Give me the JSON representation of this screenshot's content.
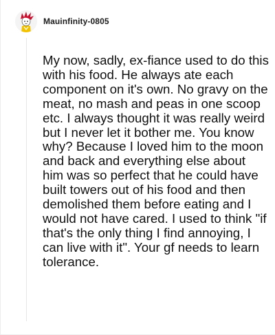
{
  "comment": {
    "username": "Mauinfinity-0805",
    "avatar_icon": "cartoon-character-avatar",
    "body": "My now, sadly, ex-fiance used to do this with his food. He always ate each component on it's own. No gravy on the meat, no mash and peas in one scoop etc. I always thought it was really weird but I never let it bother me. You know why? Because I loved him to the moon and back and everything else about him was so perfect that he could have built towers out of his food and then demolished them before eating and I would not have cared. I used to think \"if that's the only thing I find annoying, I can live with it\". Your gf needs to learn tolerance."
  },
  "colors": {
    "avatar_hair": "#c8102e",
    "avatar_body": "#f2c200",
    "thread_line": "#e6e6e6"
  }
}
